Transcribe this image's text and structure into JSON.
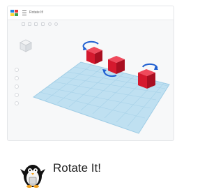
{
  "app": {
    "name": "Tinkercad",
    "design_title": "Rotate It!"
  },
  "lesson": {
    "title": "Rotate It!"
  },
  "colors": {
    "workplane": "#bfe0f1",
    "grid": "#a6d1e8",
    "cube": "#d5192e",
    "rotate_arrow": "#1f5fd1"
  },
  "icons": {
    "app_logo": "tinkercad-logo-icon",
    "menu": "hamburger-menu-icon",
    "view_cube": "view-cube-icon",
    "rotate": "rotate-arrow-icon",
    "avatar": "penguin-icon"
  }
}
